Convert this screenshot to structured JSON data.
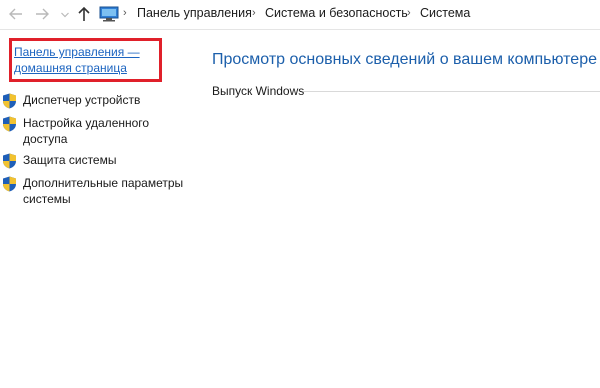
{
  "nav": {
    "back_icon": "arrow-left-icon",
    "forward_icon": "arrow-right-icon",
    "up_icon": "arrow-up-icon",
    "location_icon": "monitor-icon",
    "breadcrumbs": [
      "Панель управления",
      "Система и безопасность",
      "Система"
    ]
  },
  "sidebar": {
    "home_link": {
      "line1": "Панель управления —",
      "line2": "домашняя страница"
    },
    "items": [
      {
        "label": "Диспетчер устройств",
        "icon": "shield-icon"
      },
      {
        "label": "Настройка удаленного доступа",
        "icon": "shield-icon"
      },
      {
        "label": "Защита системы",
        "icon": "shield-icon"
      },
      {
        "label": "Дополнительные параметры системы",
        "icon": "shield-icon"
      }
    ]
  },
  "main": {
    "title": "Просмотр основных сведений о вашем компьютере",
    "section_edition": "Выпуск Windows"
  },
  "colors": {
    "link": "#1c64c0",
    "title": "#1c5fab",
    "highlight_box": "#e0202a",
    "shield_blue": "#1f5fb8",
    "shield_yellow": "#f2c230"
  }
}
